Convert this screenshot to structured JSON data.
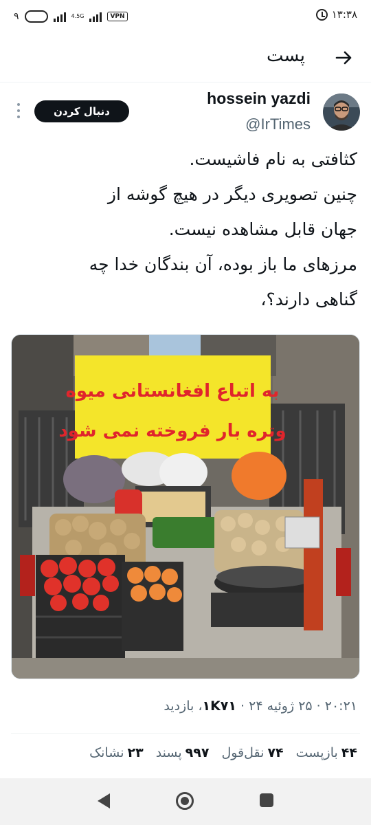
{
  "status_bar": {
    "left_text": "۹",
    "network": "4.5G",
    "vpn": "VPN",
    "time": "۱۳:۳۸"
  },
  "header": {
    "title": "پست"
  },
  "author": {
    "name": "hossein yazdi",
    "handle": "@IrTimes",
    "follow_label": "دنبال کردن"
  },
  "tweet": {
    "lines": [
      "کثافتی به نام فاشیست.",
      "چنین تصویری دیگر در هیچ گوشه از",
      "جهان قابل مشاهده نیست.",
      "مرزهای ما باز بوده، آن بندگان خدا چه",
      "گناهی دارند؟،"
    ]
  },
  "photo": {
    "banner_line1": "به اتباع افغانستانی میوه",
    "banner_line2": "وتره بار فروخته نمی شود"
  },
  "meta": {
    "time": "۲۰:۲۱",
    "date": "۲۵ ژوئیه ۲۴",
    "views_count": "۱K۷۱",
    "views_label": "بازدید"
  },
  "stats": {
    "reposts_count": "۴۴",
    "reposts_label": "بازپست",
    "quotes_count": "۷۴",
    "quotes_label": "نقل‌قول",
    "likes_count": "۹۹۷",
    "likes_label": "پسند",
    "bookmarks_count": "۲۳",
    "bookmarks_label": "نشانک"
  },
  "colors": {
    "text": "#0f1419",
    "secondary": "#536471",
    "banner_yellow": "#f4e52a",
    "banner_red": "#e0252c"
  }
}
